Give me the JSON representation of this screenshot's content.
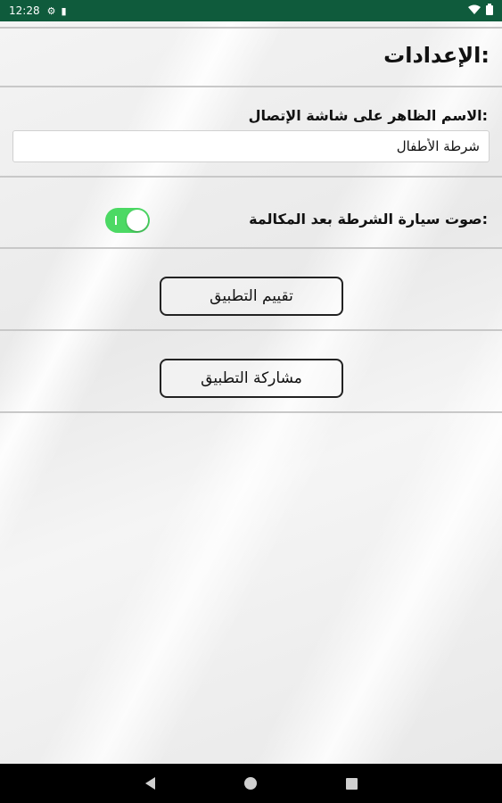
{
  "status_bar": {
    "time": "12:28",
    "icons": [
      "settings-icon",
      "sd-card-icon",
      "wifi-icon",
      "battery-icon"
    ]
  },
  "settings": {
    "title": "الإعدادات:",
    "display_name_label": "الاسم الظاهر على شاشة الإتصال:",
    "display_name_value": "شرطة الأطفال",
    "siren_sound_label": "صوت سيارة الشرطة بعد المكالمة:",
    "siren_sound_enabled": true,
    "rate_button": "تقييم التطبيق",
    "share_button": "مشاركة التطبيق"
  },
  "colors": {
    "status_bar": "#0f5b3c",
    "toggle_on": "#4cd964"
  },
  "nav_bar": {
    "icons": [
      "back-icon",
      "home-icon",
      "recents-icon"
    ]
  }
}
